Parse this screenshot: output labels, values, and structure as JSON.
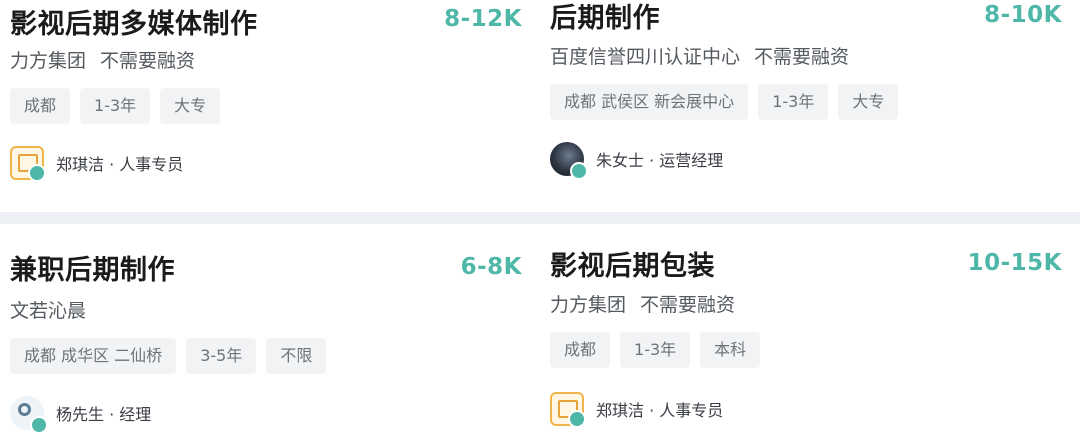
{
  "jobs": [
    {
      "title": "影视后期多媒体制作",
      "salary": "8-12K",
      "company": "力方集团",
      "funding": "不需要融资",
      "tags": [
        "成都",
        "1-3年",
        "大专"
      ],
      "recruiter": "郑琪洁 · 人事专员",
      "avatar_icon": "company-logo-icon"
    },
    {
      "title": "后期制作",
      "salary": "8-10K",
      "company": "百度信誉四川认证中心",
      "funding": "不需要融资",
      "tags": [
        "成都 武侯区 新会展中心",
        "1-3年",
        "大专"
      ],
      "recruiter": "朱女士 · 运营经理",
      "avatar_icon": "user-photo-icon"
    },
    {
      "title": "兼职后期制作",
      "salary": "6-8K",
      "company": "文若沁晨",
      "funding": "",
      "tags": [
        "成都 成华区 二仙桥",
        "3-5年",
        "不限"
      ],
      "recruiter": "杨先生 · 经理",
      "avatar_icon": "company-logo-icon"
    },
    {
      "title": "影视后期包装",
      "salary": "10-15K",
      "company": "力方集团",
      "funding": "不需要融资",
      "tags": [
        "成都",
        "1-3年",
        "本科"
      ],
      "recruiter": "郑琪洁 · 人事专员",
      "avatar_icon": "company-logo-icon"
    }
  ],
  "colors": {
    "salary": "#4fb7a8",
    "tag_bg": "#f2f3f5",
    "page_bg": "#eceff3"
  }
}
